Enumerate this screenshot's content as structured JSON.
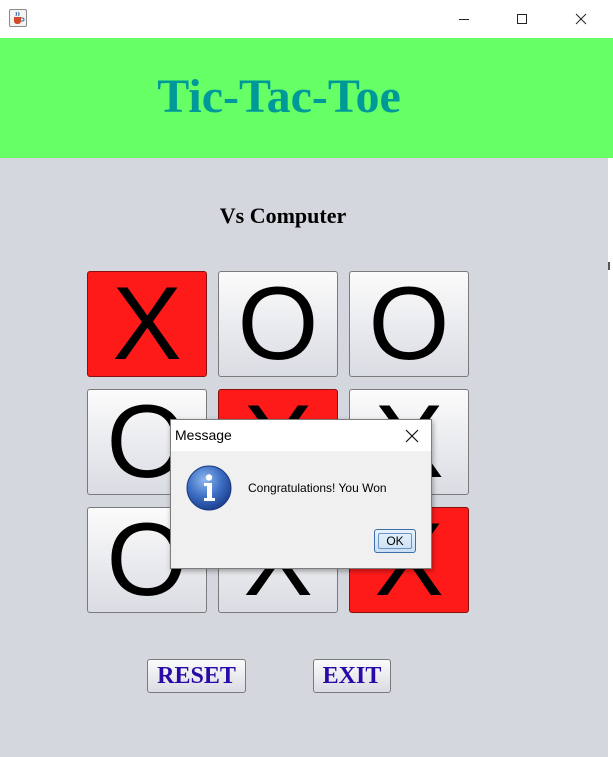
{
  "window": {
    "icon": "java-cup-icon",
    "controls": {
      "minimize": "minimize-icon",
      "maximize": "maximize-icon",
      "close": "close-icon"
    }
  },
  "header": {
    "title": "Tic-Tac-Toe",
    "background": "#66ff66",
    "title_color": "#009999"
  },
  "mode_label": "Vs Computer",
  "board": {
    "cells": [
      "X",
      "O",
      "O",
      "O",
      "X",
      "X",
      "O",
      "X",
      "X"
    ],
    "winning_cells": [
      0,
      4,
      8
    ],
    "win_color": "#ff1a1a"
  },
  "buttons": {
    "reset": "RESET",
    "exit": "EXIT",
    "label_color": "#2a0aa6"
  },
  "dialog": {
    "title": "Message",
    "message": "Congratulations! You Won",
    "ok_label": "OK",
    "icon": "info-icon"
  }
}
